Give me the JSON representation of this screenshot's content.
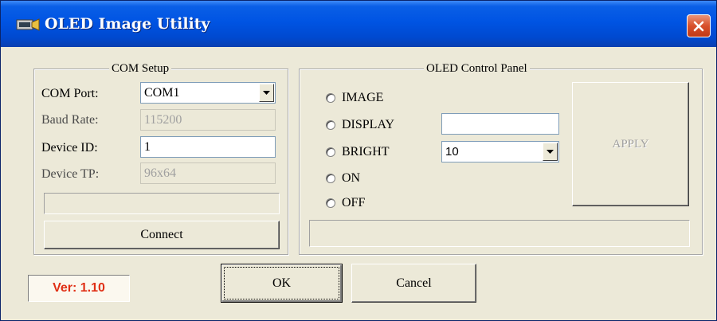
{
  "window": {
    "title": "OLED Image Utility"
  },
  "com_setup": {
    "legend": "COM Setup",
    "com_port_label": "COM Port:",
    "com_port_value": "COM1",
    "baud_rate_label": "Baud Rate:",
    "baud_rate_value": "115200",
    "device_id_label": "Device ID:",
    "device_id_value": "1",
    "device_tp_label": "Device TP:",
    "device_tp_value": "96x64",
    "connect_label": "Connect"
  },
  "control_panel": {
    "legend": "OLED Control Panel",
    "radios": [
      {
        "label": "IMAGE"
      },
      {
        "label": "DISPLAY"
      },
      {
        "label": "BRIGHT"
      },
      {
        "label": "ON"
      },
      {
        "label": "OFF"
      }
    ],
    "display_value": "",
    "bright_value": "10",
    "apply_label": "APPLY"
  },
  "footer": {
    "version_text": "Ver: 1.10",
    "ok_label": "OK",
    "cancel_label": "Cancel"
  },
  "colors": {
    "titlebar": "#0054e3",
    "close_button": "#d8502b",
    "dialog_background": "#ece9d8",
    "version_text": "#e03016"
  }
}
